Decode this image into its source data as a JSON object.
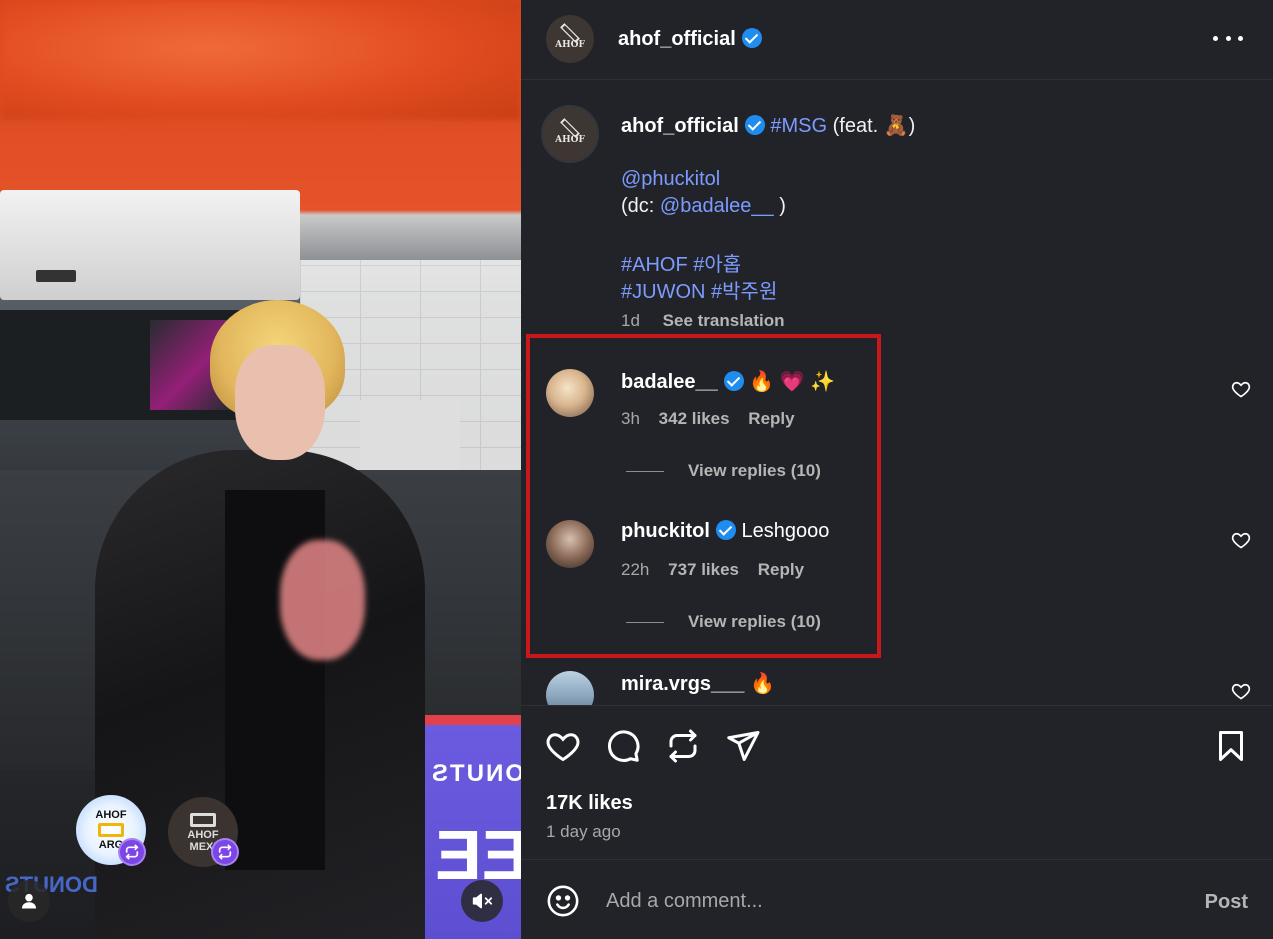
{
  "post": {
    "username": "ahof_official",
    "avatar_text": "AHOF",
    "more_icon": "more-horizontal-icon"
  },
  "caption": {
    "username": "ahof_official",
    "hashtag_msg": "#MSG",
    "feat_open": "(feat. ",
    "feat_emoji": "🧸",
    "feat_close": ")",
    "mention": "@phuckitol",
    "dc_open": "(dc: ",
    "dc_mention": "@badalee__",
    "dc_close": " )",
    "tag_ahof": "#AHOF",
    "tag_ahop_kr": "#아홉",
    "tag_juwon": "#JUWON",
    "tag_juwon_kr": "#박주원",
    "time": "1d",
    "see_translation": "See translation"
  },
  "comments": [
    {
      "username": "badalee__",
      "verified": true,
      "text": "🔥 💗 ✨",
      "time": "3h",
      "likes": "342 likes",
      "reply": "Reply",
      "view_replies": "View replies (10)"
    },
    {
      "username": "phuckitol",
      "verified": true,
      "text": "Leshgooo",
      "time": "22h",
      "likes": "737 likes",
      "reply": "Reply",
      "view_replies": "View replies (10)"
    },
    {
      "username": "mira.vrgs___",
      "verified": false,
      "text": "🔥"
    }
  ],
  "media": {
    "collab_1_text": "AHOF",
    "collab_1_sub": "ARG",
    "collab_2_text": "AHOF",
    "collab_2_sub": "MEXI",
    "panel_text": "DONUTS",
    "panel_text_big": "EE",
    "bottom_text": "DONUTS",
    "mute_icon": "volume-muted-icon",
    "user_icon": "user-tag-icon"
  },
  "actions": {
    "likes": "17K likes",
    "time_ago": "1 day ago"
  },
  "composer": {
    "placeholder": "Add a comment...",
    "post_label": "Post"
  },
  "colors": {
    "panel_bg": "#212328",
    "link": "#7d9bff",
    "verified": "#1f8cf0",
    "highlight_border": "#c8181c",
    "repost_badge": "#7b45e8"
  }
}
